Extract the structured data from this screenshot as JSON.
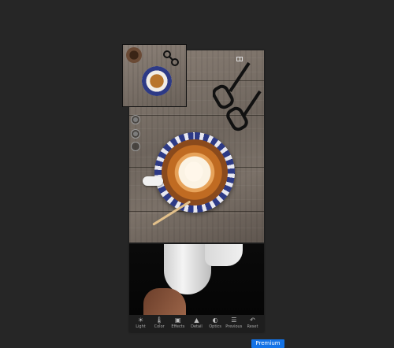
{
  "toolbar": {
    "items": [
      {
        "label": "Light",
        "icon": "sun-icon"
      },
      {
        "label": "Color",
        "icon": "thermometer-icon"
      },
      {
        "label": "Effects",
        "icon": "effects-icon"
      },
      {
        "label": "Detail",
        "icon": "triangle-icon"
      },
      {
        "label": "Optics",
        "icon": "lens-icon"
      },
      {
        "label": "Previous",
        "icon": "previous-icon"
      },
      {
        "label": "Reset",
        "icon": "reset-icon"
      }
    ]
  },
  "premium": {
    "label": "Premium"
  },
  "colors": {
    "accent": "#1473e6",
    "background": "#262626"
  }
}
